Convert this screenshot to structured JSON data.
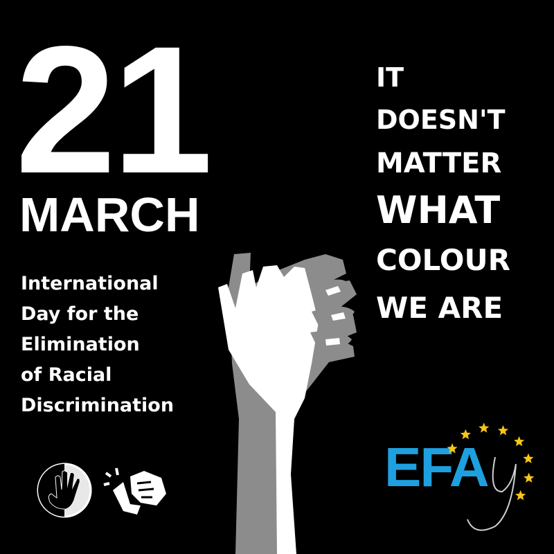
{
  "poster": {
    "date_day": "21",
    "date_month": "MARCH",
    "subtitle_lines": [
      "International",
      "Day for the",
      "Elimination",
      "of Racial",
      "Discrimination"
    ],
    "slogan_lines": [
      "IT",
      "DOESN'T",
      "MATTER",
      "WHAT",
      "COLOUR",
      "WE ARE"
    ],
    "logo_text": "EFAy"
  },
  "colors": {
    "background": "#000000",
    "text": "#ffffff",
    "efa_blue": "#1ea0e0",
    "stars": "#f5c518",
    "gray_hand": "#8c8c8c"
  },
  "icons": [
    "hand-circle-logo",
    "fist-smashing-swastika-logo",
    "clasped-hands-illustration",
    "eu-stars"
  ]
}
